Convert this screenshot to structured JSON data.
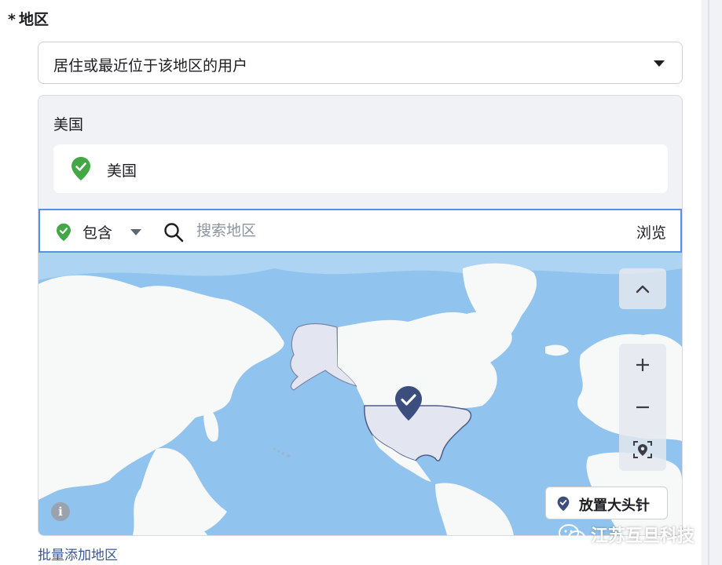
{
  "section": {
    "required_mark": "*",
    "title": "地区"
  },
  "audience_select": {
    "value": "居住或最近位于该地区的用户"
  },
  "locations": {
    "group_title": "美国",
    "selected": [
      {
        "name": "美国",
        "status": "included"
      }
    ]
  },
  "search": {
    "inclusion_label": "包含",
    "placeholder": "搜索地区",
    "browse_label": "浏览"
  },
  "map": {
    "collapse_icon": "chevron-up-icon",
    "zoom_in_label": "+",
    "zoom_out_label": "−",
    "drop_pin_label": "放置大头针",
    "info_label": "i"
  },
  "bulk_add_label": "批量添加地区",
  "watermark": {
    "text": "江苏互旦科技"
  },
  "colors": {
    "include_green": "#42a744",
    "accent_blue": "#5b8ee6",
    "link_blue": "#385898",
    "pin_navy": "#3b4e7e",
    "ocean": "#90c4ee",
    "land": "#f7f8f8"
  }
}
